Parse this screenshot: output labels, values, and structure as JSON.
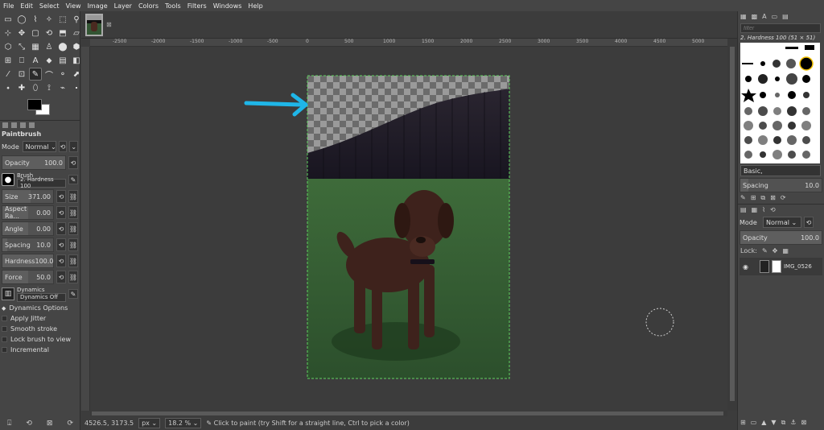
{
  "menu": [
    "File",
    "Edit",
    "Select",
    "View",
    "Image",
    "Layer",
    "Colors",
    "Tools",
    "Filters",
    "Windows",
    "Help"
  ],
  "toolbox": {
    "tools": [
      "▭",
      "◯",
      "⌇",
      "✧",
      "⬚",
      "⚲",
      "⊹",
      "✥",
      "▢",
      "⟲",
      "⬒",
      "▱",
      "⬡",
      "⤡",
      "▦",
      "♙",
      "⬤",
      "⬢",
      "⊞",
      "⎕",
      "A",
      "⬥",
      "▤",
      "◧",
      "⁄",
      "⊡",
      "✎",
      "⌒",
      "⚬",
      "⬈",
      "⬩",
      "✚",
      "⬯",
      "⟟",
      "⌁",
      "⬝"
    ],
    "active_tool_index": 26
  },
  "tool_options": {
    "title": "Paintbrush",
    "mode_label": "Mode",
    "mode_value": "Normal",
    "opacity_label": "Opacity",
    "opacity_value": "100.0",
    "brush_label": "Brush",
    "brush_value": "2. Hardness 100",
    "size_label": "Size",
    "size_value": "371.00",
    "aspect_label": "Aspect Ra...",
    "aspect_value": "0.00",
    "angle_label": "Angle",
    "angle_value": "0.00",
    "spacing_label": "Spacing",
    "spacing_value": "10.0",
    "hardness_label": "Hardness",
    "hardness_value": "100.0",
    "force_label": "Force",
    "force_value": "50.0",
    "dynamics_label": "Dynamics",
    "dynamics_value": "Dynamics Off",
    "dynamics_options": "Dynamics Options",
    "apply_jitter": "Apply Jitter",
    "smooth_stroke": "Smooth stroke",
    "lock_brush": "Lock brush to view",
    "incremental": "Incremental"
  },
  "rulers": {
    "top": [
      "-2500",
      "-2000",
      "-1500",
      "-1000",
      "-500",
      "0",
      "500",
      "1000",
      "1500",
      "2000",
      "2500",
      "3000",
      "3500",
      "4000",
      "4500",
      "5000",
      "5500"
    ]
  },
  "status": {
    "coords": "4526.5, 3173.5",
    "unit": "px",
    "zoom": "18.2 %",
    "message": "Click to paint (try Shift for a straight line, Ctrl to pick a color)"
  },
  "right_panel": {
    "filter_placeholder": "filter",
    "brush_name": "2. Hardness 100 (51 × 51)",
    "preset": "Basic,",
    "spacing_label": "Spacing",
    "spacing_value": "10.0",
    "mode_label": "Mode",
    "mode_value": "Normal",
    "opacity_label": "Opacity",
    "opacity_value": "100.0",
    "lock_label": "Lock:",
    "layer_name": "IMG_0526"
  },
  "colors": {
    "accent_arrow": "#1fb6e8",
    "foreground": "#000000",
    "background": "#ffffff"
  }
}
